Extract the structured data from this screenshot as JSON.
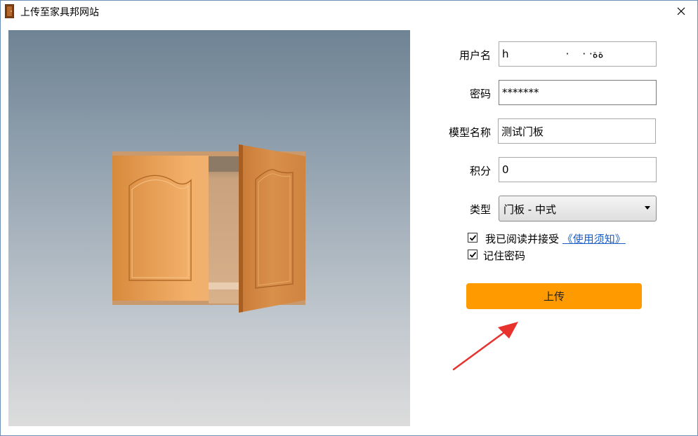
{
  "window": {
    "title": "上传至家具邦网站"
  },
  "form": {
    "username_label": "用户名",
    "username_value": "h                 ·    · ·ةة",
    "password_label": "密码",
    "password_value": "*******",
    "model_name_label": "模型名称",
    "model_name_value": "测试门板",
    "points_label": "积分",
    "points_value": "0",
    "type_label": "类型",
    "type_selected": "门板 - 中式"
  },
  "agreement": {
    "checked": true,
    "text": "我已阅读并接受",
    "link_text": "《使用须知》"
  },
  "remember": {
    "checked": true,
    "text": "记住密码"
  },
  "upload_button": {
    "label": "上传"
  },
  "colors": {
    "accent": "#ff9a00",
    "link": "#1a5fc8",
    "annotation_arrow": "#e8322e"
  },
  "icons": {
    "app": "cabinet-door-icon",
    "close": "close-icon",
    "dropdown": "chevron-down-icon",
    "check": "checkmark-icon"
  }
}
